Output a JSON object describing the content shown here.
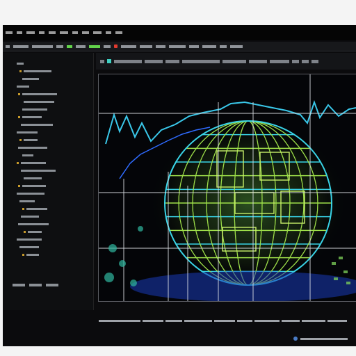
{
  "window": {
    "title": ""
  },
  "menubar": {
    "items": [
      "",
      "",
      "",
      "",
      "",
      "",
      "",
      "",
      "",
      "",
      ""
    ]
  },
  "toolbar": {
    "items": [
      "",
      "",
      "",
      "",
      "",
      "",
      "",
      "",
      "",
      "",
      "",
      "",
      "",
      "",
      "",
      "",
      ""
    ]
  },
  "viewport_toolbar": {
    "items": [
      "",
      "",
      "",
      "",
      "",
      "",
      "",
      "",
      "",
      "",
      "",
      ""
    ]
  },
  "sidebar": {
    "tree_items": [
      "",
      "",
      "",
      "",
      "",
      "",
      "",
      "",
      "",
      "",
      "",
      "",
      "",
      "",
      "",
      "",
      "",
      "",
      "",
      "",
      "",
      "",
      "",
      "",
      "",
      ""
    ],
    "bottom_buttons": [
      "",
      "",
      ""
    ]
  },
  "statusbar": {
    "text": ""
  },
  "footer": {
    "status_text": ""
  },
  "colors": {
    "background": "#0b0b0d",
    "wireframe_green": "#9fe04a",
    "wireframe_cyan": "#39d3e6",
    "wireframe_blue": "#2f6bff",
    "grid_white": "#d9dde3"
  },
  "icons": [
    "folder-icon",
    "eye-icon",
    "camera-icon",
    "settings-icon",
    "info-icon"
  ]
}
